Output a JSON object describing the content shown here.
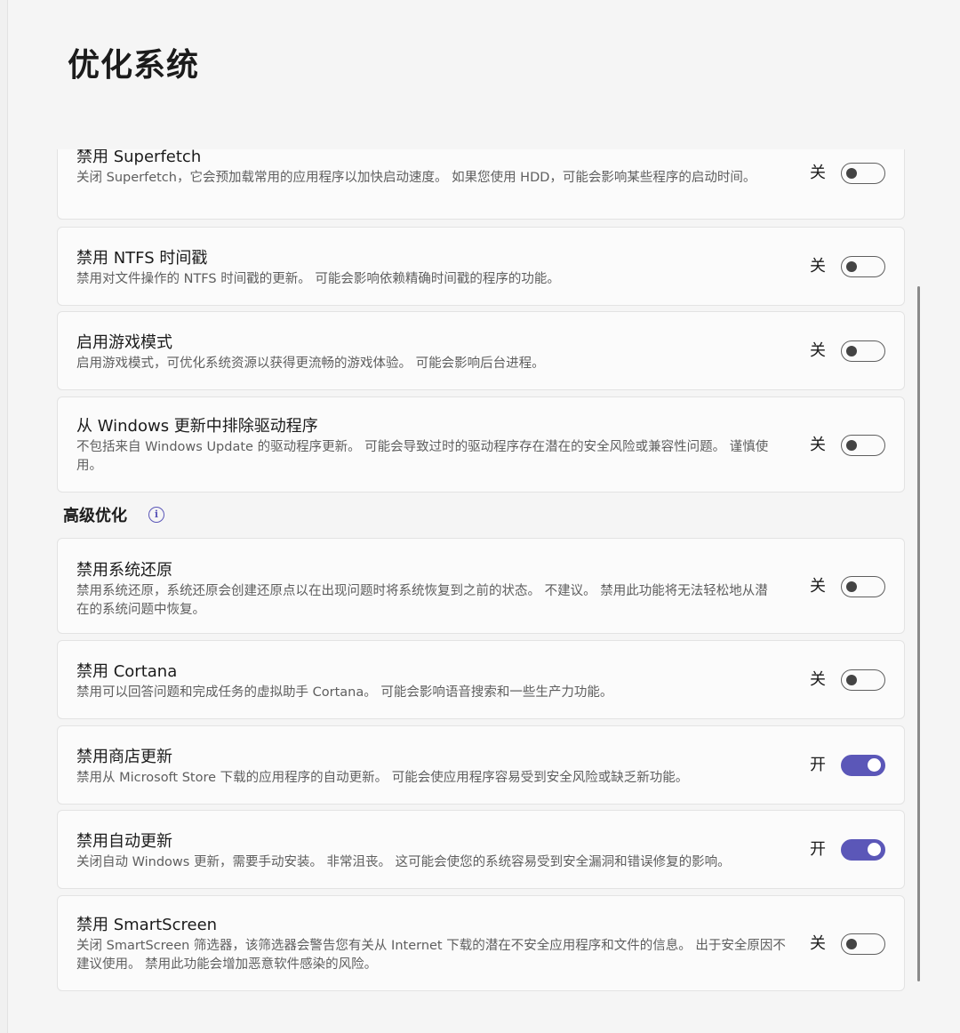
{
  "page": {
    "title": "优化系统"
  },
  "colors": {
    "accent": "#5b57b8",
    "card_bg": "#fbfbfb",
    "window_bg": "#f5f5f5"
  },
  "settings_top": [
    {
      "title": "禁用 Superfetch",
      "desc": "关闭 Superfetch，它会预加载常用的应用程序以加快启动速度。 如果您使用 HDD，可能会影响某些程序的启动时间。",
      "state": "关",
      "on": false
    },
    {
      "title": "禁用 NTFS 时间戳",
      "desc": "禁用对文件操作的 NTFS 时间戳的更新。 可能会影响依赖精确时间戳的程序的功能。",
      "state": "关",
      "on": false
    },
    {
      "title": "启用游戏模式",
      "desc": "启用游戏模式，可优化系统资源以获得更流畅的游戏体验。 可能会影响后台进程。",
      "state": "关",
      "on": false
    },
    {
      "title": "从 Windows 更新中排除驱动程序",
      "desc": "不包括来自 Windows Update 的驱动程序更新。 可能会导致过时的驱动程序存在潜在的安全风险或兼容性问题。 谨慎使用。",
      "state": "关",
      "on": false
    }
  ],
  "advanced": {
    "header": "高级优化",
    "info_icon": "i",
    "items": [
      {
        "title": "禁用系统还原",
        "desc": "禁用系统还原，系统还原会创建还原点以在出现问题时将系统恢复到之前的状态。 不建议。 禁用此功能将无法轻松地从潜在的系统问题中恢复。",
        "state": "关",
        "on": false
      },
      {
        "title": "禁用 Cortana",
        "desc": "禁用可以回答问题和完成任务的虚拟助手 Cortana。 可能会影响语音搜索和一些生产力功能。",
        "state": "关",
        "on": false
      },
      {
        "title": "禁用商店更新",
        "desc": "禁用从 Microsoft Store 下载的应用程序的自动更新。 可能会使应用程序容易受到安全风险或缺乏新功能。",
        "state": "开",
        "on": true
      },
      {
        "title": "禁用自动更新",
        "desc": "关闭自动 Windows 更新，需要手动安装。 非常沮丧。 这可能会使您的系统容易受到安全漏洞和错误修复的影响。",
        "state": "开",
        "on": true
      },
      {
        "title": "禁用 SmartScreen",
        "desc": "关闭 SmartScreen 筛选器，该筛选器会警告您有关从 Internet 下载的潜在不安全应用程序和文件的信息。 出于安全原因不建议使用。 禁用此功能会增加恶意软件感染的风险。",
        "state": "关",
        "on": false
      }
    ]
  }
}
